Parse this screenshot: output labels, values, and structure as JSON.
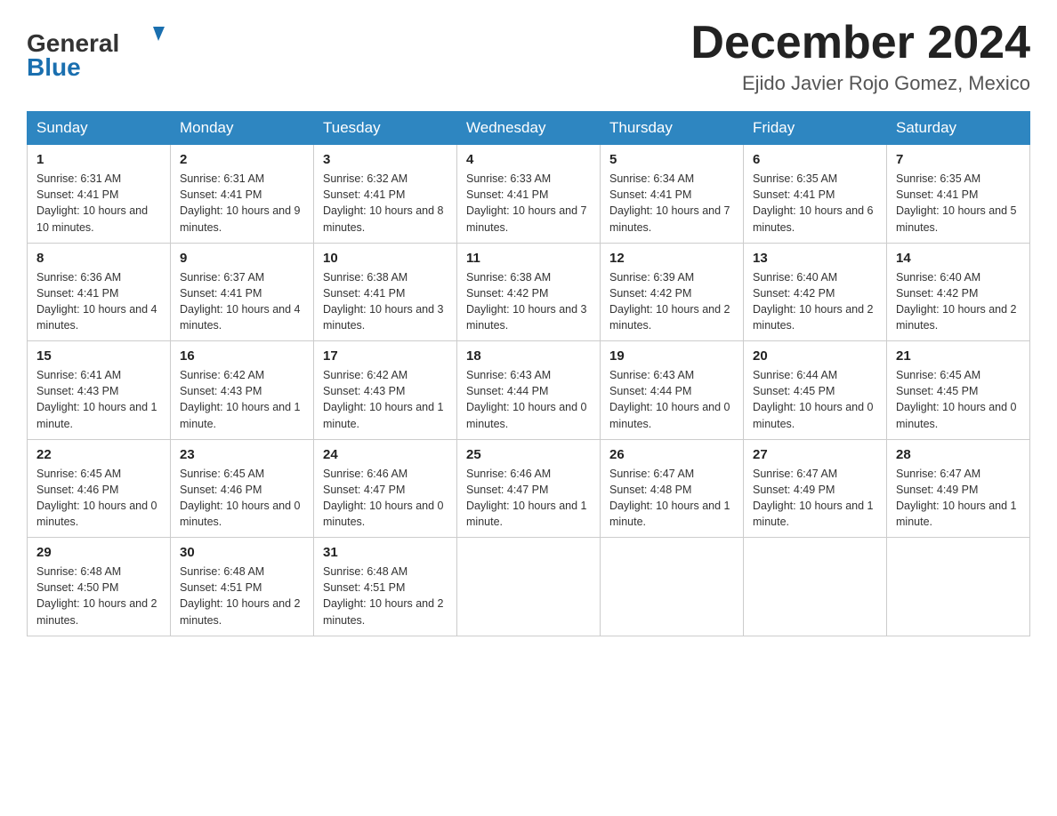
{
  "header": {
    "logo_line1": "General",
    "logo_line2": "Blue",
    "month_title": "December 2024",
    "location": "Ejido Javier Rojo Gomez, Mexico"
  },
  "weekdays": [
    "Sunday",
    "Monday",
    "Tuesday",
    "Wednesday",
    "Thursday",
    "Friday",
    "Saturday"
  ],
  "weeks": [
    [
      {
        "day": "1",
        "sunrise": "6:31 AM",
        "sunset": "4:41 PM",
        "daylight": "10 hours and 10 minutes."
      },
      {
        "day": "2",
        "sunrise": "6:31 AM",
        "sunset": "4:41 PM",
        "daylight": "10 hours and 9 minutes."
      },
      {
        "day": "3",
        "sunrise": "6:32 AM",
        "sunset": "4:41 PM",
        "daylight": "10 hours and 8 minutes."
      },
      {
        "day": "4",
        "sunrise": "6:33 AM",
        "sunset": "4:41 PM",
        "daylight": "10 hours and 7 minutes."
      },
      {
        "day": "5",
        "sunrise": "6:34 AM",
        "sunset": "4:41 PM",
        "daylight": "10 hours and 7 minutes."
      },
      {
        "day": "6",
        "sunrise": "6:35 AM",
        "sunset": "4:41 PM",
        "daylight": "10 hours and 6 minutes."
      },
      {
        "day": "7",
        "sunrise": "6:35 AM",
        "sunset": "4:41 PM",
        "daylight": "10 hours and 5 minutes."
      }
    ],
    [
      {
        "day": "8",
        "sunrise": "6:36 AM",
        "sunset": "4:41 PM",
        "daylight": "10 hours and 4 minutes."
      },
      {
        "day": "9",
        "sunrise": "6:37 AM",
        "sunset": "4:41 PM",
        "daylight": "10 hours and 4 minutes."
      },
      {
        "day": "10",
        "sunrise": "6:38 AM",
        "sunset": "4:41 PM",
        "daylight": "10 hours and 3 minutes."
      },
      {
        "day": "11",
        "sunrise": "6:38 AM",
        "sunset": "4:42 PM",
        "daylight": "10 hours and 3 minutes."
      },
      {
        "day": "12",
        "sunrise": "6:39 AM",
        "sunset": "4:42 PM",
        "daylight": "10 hours and 2 minutes."
      },
      {
        "day": "13",
        "sunrise": "6:40 AM",
        "sunset": "4:42 PM",
        "daylight": "10 hours and 2 minutes."
      },
      {
        "day": "14",
        "sunrise": "6:40 AM",
        "sunset": "4:42 PM",
        "daylight": "10 hours and 2 minutes."
      }
    ],
    [
      {
        "day": "15",
        "sunrise": "6:41 AM",
        "sunset": "4:43 PM",
        "daylight": "10 hours and 1 minute."
      },
      {
        "day": "16",
        "sunrise": "6:42 AM",
        "sunset": "4:43 PM",
        "daylight": "10 hours and 1 minute."
      },
      {
        "day": "17",
        "sunrise": "6:42 AM",
        "sunset": "4:43 PM",
        "daylight": "10 hours and 1 minute."
      },
      {
        "day": "18",
        "sunrise": "6:43 AM",
        "sunset": "4:44 PM",
        "daylight": "10 hours and 0 minutes."
      },
      {
        "day": "19",
        "sunrise": "6:43 AM",
        "sunset": "4:44 PM",
        "daylight": "10 hours and 0 minutes."
      },
      {
        "day": "20",
        "sunrise": "6:44 AM",
        "sunset": "4:45 PM",
        "daylight": "10 hours and 0 minutes."
      },
      {
        "day": "21",
        "sunrise": "6:45 AM",
        "sunset": "4:45 PM",
        "daylight": "10 hours and 0 minutes."
      }
    ],
    [
      {
        "day": "22",
        "sunrise": "6:45 AM",
        "sunset": "4:46 PM",
        "daylight": "10 hours and 0 minutes."
      },
      {
        "day": "23",
        "sunrise": "6:45 AM",
        "sunset": "4:46 PM",
        "daylight": "10 hours and 0 minutes."
      },
      {
        "day": "24",
        "sunrise": "6:46 AM",
        "sunset": "4:47 PM",
        "daylight": "10 hours and 0 minutes."
      },
      {
        "day": "25",
        "sunrise": "6:46 AM",
        "sunset": "4:47 PM",
        "daylight": "10 hours and 1 minute."
      },
      {
        "day": "26",
        "sunrise": "6:47 AM",
        "sunset": "4:48 PM",
        "daylight": "10 hours and 1 minute."
      },
      {
        "day": "27",
        "sunrise": "6:47 AM",
        "sunset": "4:49 PM",
        "daylight": "10 hours and 1 minute."
      },
      {
        "day": "28",
        "sunrise": "6:47 AM",
        "sunset": "4:49 PM",
        "daylight": "10 hours and 1 minute."
      }
    ],
    [
      {
        "day": "29",
        "sunrise": "6:48 AM",
        "sunset": "4:50 PM",
        "daylight": "10 hours and 2 minutes."
      },
      {
        "day": "30",
        "sunrise": "6:48 AM",
        "sunset": "4:51 PM",
        "daylight": "10 hours and 2 minutes."
      },
      {
        "day": "31",
        "sunrise": "6:48 AM",
        "sunset": "4:51 PM",
        "daylight": "10 hours and 2 minutes."
      },
      null,
      null,
      null,
      null
    ]
  ]
}
